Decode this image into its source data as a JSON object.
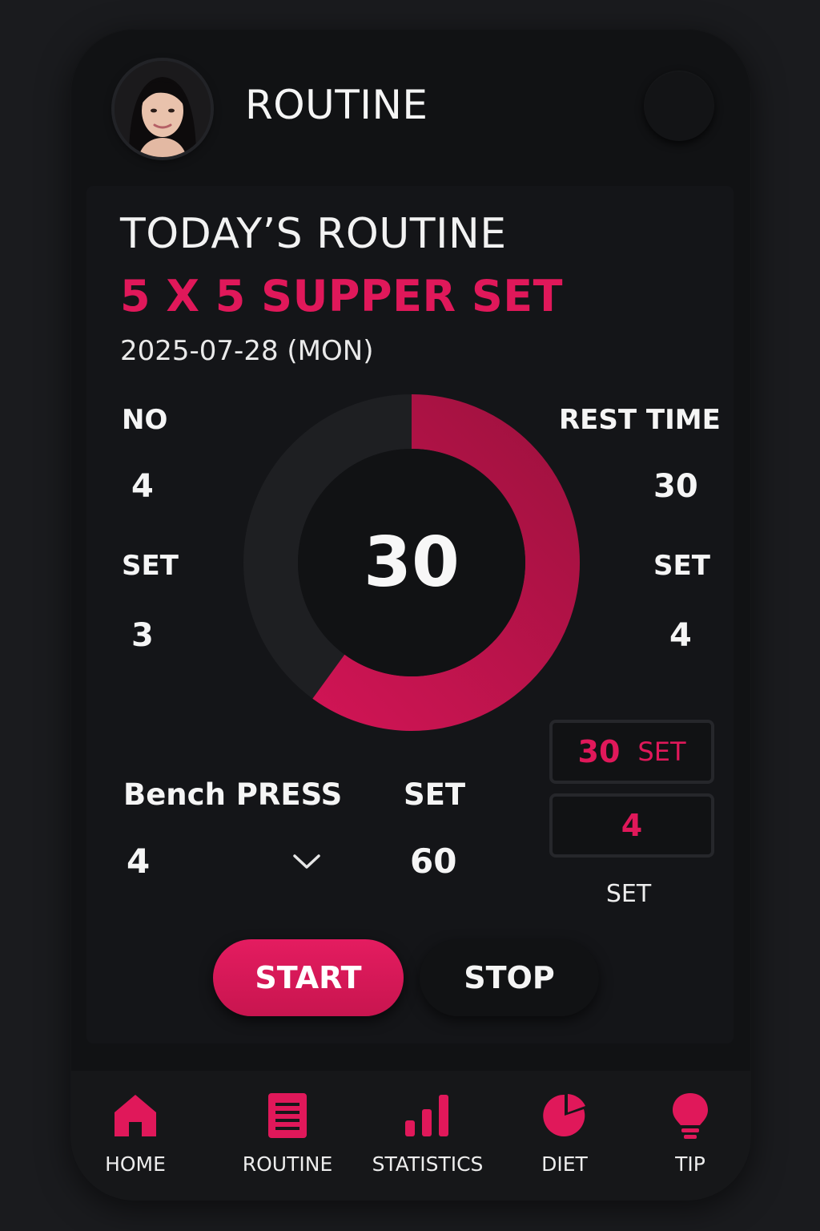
{
  "header": {
    "title": "ROUTINE",
    "avatar_icon": "user-avatar-icon",
    "menu_icon": "menu-button-icon"
  },
  "routine": {
    "heading": "TODAY’S ROUTINE",
    "name": "5 X 5 SUPPER SET",
    "date": "2025-07-28 (MON)"
  },
  "stats": {
    "left": [
      {
        "label": "NO",
        "value": "4"
      },
      {
        "label": "SET",
        "value": "3"
      }
    ],
    "right": [
      {
        "label": "REST TIME",
        "value": "30"
      },
      {
        "label": "SET",
        "value": "4"
      }
    ]
  },
  "timer": {
    "value": "30",
    "progress_fraction": 0.6,
    "accent_color": "#e0185a",
    "track_color": "#1e1f22"
  },
  "exercise": {
    "name": "Bench PRESS",
    "count": "4",
    "dropdown_icon": "chevron-down-icon",
    "set_label": "SET",
    "set_value": "60"
  },
  "set_boxes": {
    "box1_value": "30",
    "box1_unit": "SET",
    "box2_value": "4",
    "caption": "SET"
  },
  "controls": {
    "start_label": "START",
    "stop_label": "STOP"
  },
  "nav": [
    {
      "label": "HOME",
      "icon": "home-icon"
    },
    {
      "label": "ROUTINE",
      "icon": "document-icon"
    },
    {
      "label": "STATISTICS",
      "icon": "bar-chart-icon"
    },
    {
      "label": "DIET",
      "icon": "pie-chart-icon"
    },
    {
      "label": "TIP",
      "icon": "lightbulb-icon"
    }
  ],
  "colors": {
    "accent": "#e0185a",
    "background": "#111214"
  }
}
